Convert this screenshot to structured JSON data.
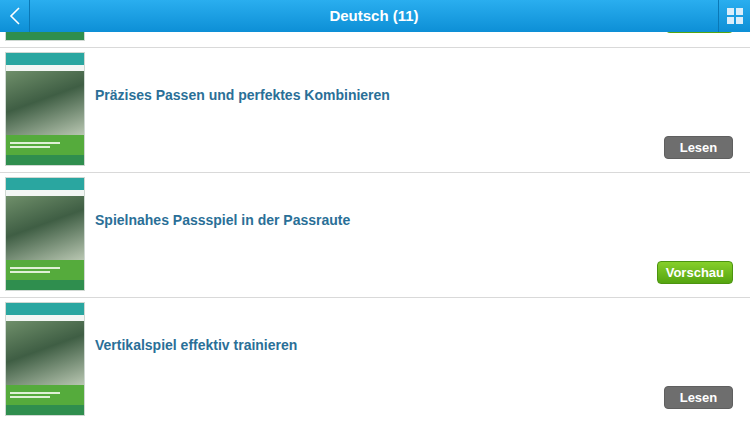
{
  "header": {
    "title": "Deutsch (11)"
  },
  "partial_item": {
    "button_kind": "preview"
  },
  "items": [
    {
      "title": "Präzises Passen und perfektes Kombinieren",
      "button": {
        "label": "Lesen",
        "kind": "read"
      }
    },
    {
      "title": "Spielnahes Passspiel in der Passraute",
      "button": {
        "label": "Vorschau",
        "kind": "preview"
      }
    },
    {
      "title": "Vertikalspiel effektiv trainieren",
      "button": {
        "label": "Lesen",
        "kind": "read"
      }
    }
  ]
}
